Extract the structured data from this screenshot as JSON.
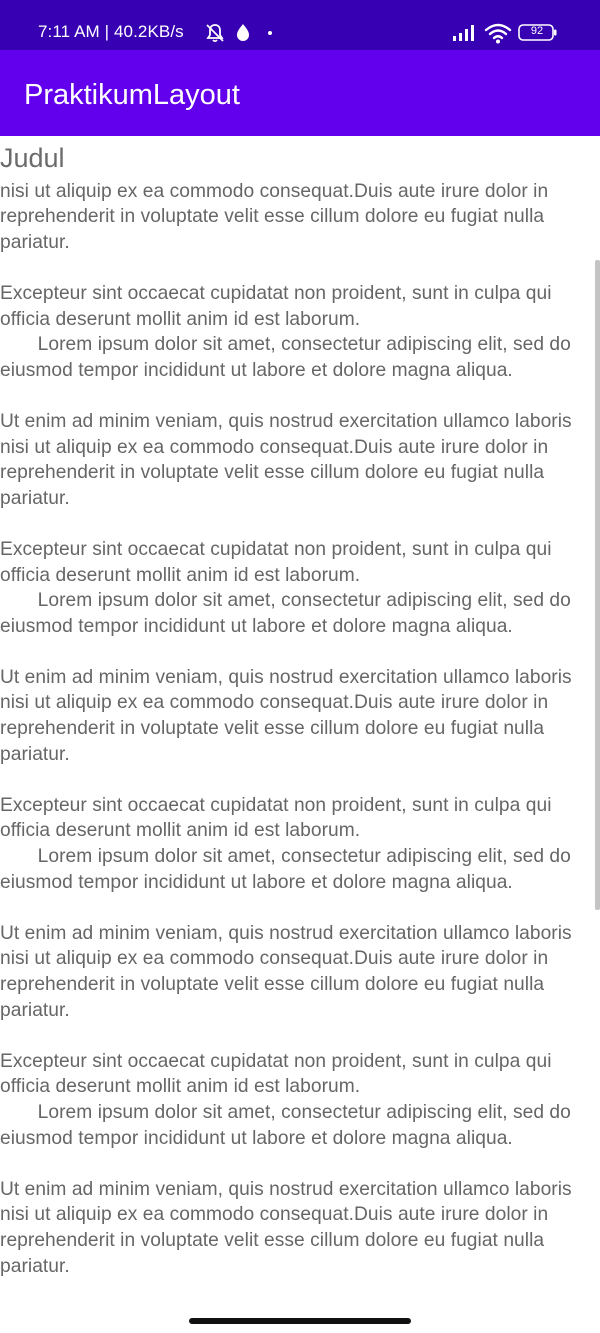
{
  "status_bar": {
    "time_and_speed": "7:11 AM | 40.2KB/s",
    "battery_level": "92",
    "icons": [
      "bell-off-icon",
      "drop-icon",
      "dot-icon",
      "signal-icon",
      "wifi-icon",
      "battery-icon"
    ]
  },
  "app_bar": {
    "title": "PraktikumLayout",
    "color": "#6200EE",
    "status_color": "#3700B3"
  },
  "content": {
    "heading": "Judul",
    "paragraph_a": "Ut enim ad minim veniam, quis nostrud exercitation ullamco laboris nisi ut aliquip ex ea commodo consequat.Duis aute irure dolor in reprehenderit in voluptate velit esse cillum dolore eu fugiat nulla pariatur.",
    "paragraph_b": "Excepteur sint occaecat cupidatat non proident, sunt in culpa qui officia deserunt mollit anim id est laborum.",
    "paragraph_c": "Lorem ipsum dolor sit amet, consectetur adipiscing elit, sed do eiusmod tempor incididunt ut labore et dolore magna aliqua."
  }
}
